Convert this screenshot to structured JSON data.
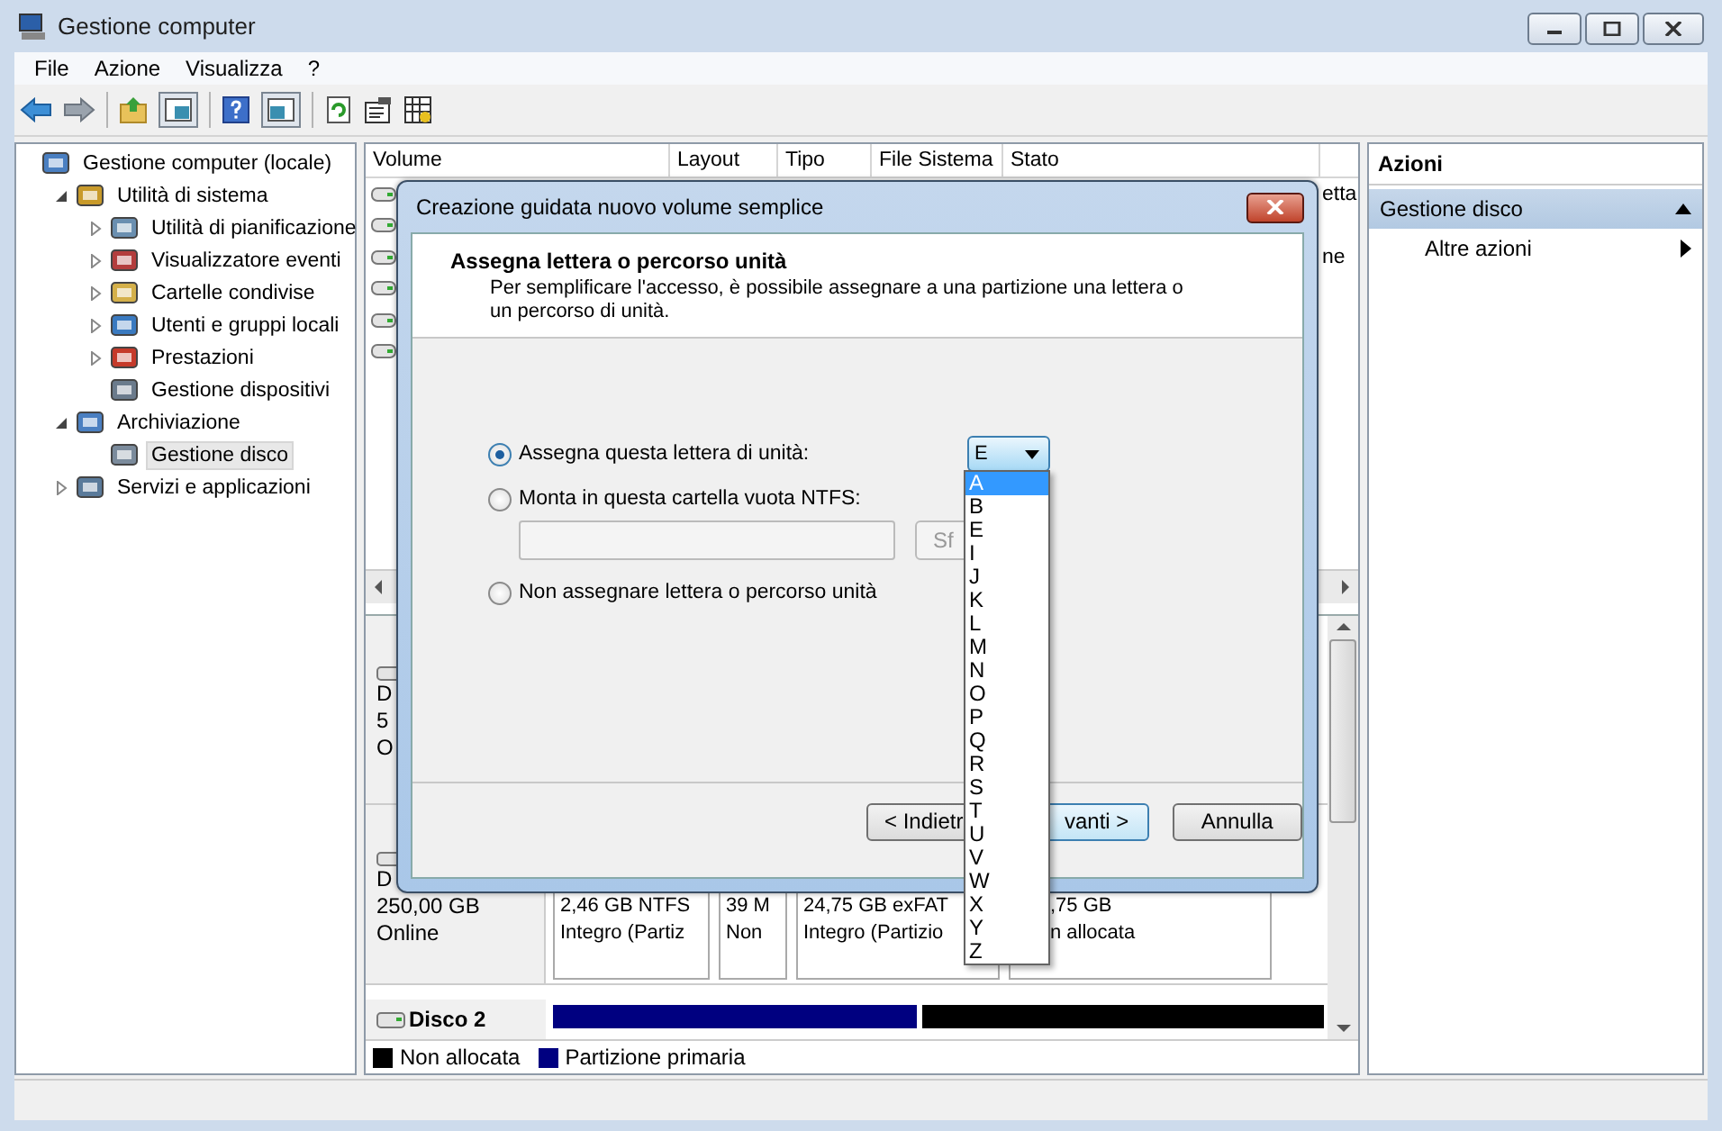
{
  "window": {
    "title": "Gestione computer"
  },
  "menu": [
    "File",
    "Azione",
    "Visualizza",
    "?"
  ],
  "tree": [
    {
      "label": "Gestione computer (locale)",
      "selected": false,
      "children": [
        {
          "label": "Utilità di sistema",
          "expanded": true,
          "selected": false,
          "children": [
            {
              "label": "Utilità di pianificazione",
              "expanded": false,
              "selected": false
            },
            {
              "label": "Visualizzatore eventi",
              "expanded": false,
              "selected": false
            },
            {
              "label": "Cartelle condivise",
              "expanded": false,
              "selected": false
            },
            {
              "label": "Utenti e gruppi locali",
              "expanded": false,
              "selected": false
            },
            {
              "label": "Prestazioni",
              "expanded": false,
              "selected": false
            },
            {
              "label": "Gestione dispositivi",
              "selected": false
            }
          ]
        },
        {
          "label": "Archiviazione",
          "expanded": true,
          "selected": false,
          "children": [
            {
              "label": "Gestione disco",
              "selected": true
            }
          ]
        },
        {
          "label": "Servizi e applicazioni",
          "expanded": false,
          "selected": false
        }
      ]
    }
  ],
  "volume_table": {
    "columns": [
      "Volume",
      "Layout",
      "Tipo",
      "File Sistema",
      "Stato"
    ],
    "rows": [
      {
        "column_6": "etta"
      },
      {},
      {
        "column_6": "ne"
      },
      {},
      {},
      {}
    ]
  },
  "disks": [
    {
      "info": [
        "D",
        "5",
        "O"
      ]
    },
    {
      "info": [
        "D",
        "250,00 GB",
        "Online"
      ],
      "partitions": [
        {
          "size": "2,46 GB NTFS",
          "status": "Integro (Partiz"
        },
        {
          "size": "39 M",
          "status": "Non"
        },
        {
          "size": "24,75 GB exFAT",
          "status": "Integro (Partizio"
        },
        {
          "size": ",75 GB",
          "status": "n allocata"
        }
      ]
    },
    {
      "name": "Disco 2",
      "bars": [
        {
          "color": "#000080"
        },
        {
          "color": "#000000"
        }
      ]
    }
  ],
  "legend": [
    {
      "label": "Non allocata",
      "color": "#000000"
    },
    {
      "label": "Partizione primaria",
      "color": "#000080"
    }
  ],
  "actions": {
    "title": "Azioni",
    "section": "Gestione disco",
    "items": [
      "Altre azioni"
    ]
  },
  "dialog": {
    "title": "Creazione guidata nuovo volume semplice",
    "heading": "Assegna lettera o percorso unità",
    "description": "Per semplificare l'accesso, è possibile assegnare a una partizione una lettera o un percorso di unità.",
    "options": [
      {
        "label": "Assegna questa lettera di unità:",
        "selected": true
      },
      {
        "label": "Monta in questa cartella vuota NTFS:",
        "selected": false
      },
      {
        "label": "Non assegnare lettera o percorso unità",
        "selected": false
      }
    ],
    "drive_letter": "E",
    "browse_button": "Sf",
    "letters": [
      {
        "label": "A",
        "selected": true
      },
      {
        "label": "B",
        "selected": false
      },
      {
        "label": "E",
        "selected": false
      },
      {
        "label": "I",
        "selected": false
      },
      {
        "label": "J",
        "selected": false
      },
      {
        "label": "K",
        "selected": false
      },
      {
        "label": "L",
        "selected": false
      },
      {
        "label": "M",
        "selected": false
      },
      {
        "label": "N",
        "selected": false
      },
      {
        "label": "O",
        "selected": false
      },
      {
        "label": "P",
        "selected": false
      },
      {
        "label": "Q",
        "selected": false
      },
      {
        "label": "R",
        "selected": false
      },
      {
        "label": "S",
        "selected": false
      },
      {
        "label": "T",
        "selected": false
      },
      {
        "label": "U",
        "selected": false
      },
      {
        "label": "V",
        "selected": false
      },
      {
        "label": "W",
        "selected": false
      },
      {
        "label": "X",
        "selected": false
      },
      {
        "label": "Y",
        "selected": false
      },
      {
        "label": "Z",
        "selected": false
      }
    ],
    "buttons": {
      "back": "< Indietr",
      "next": "vanti >",
      "cancel": "Annulla"
    }
  }
}
